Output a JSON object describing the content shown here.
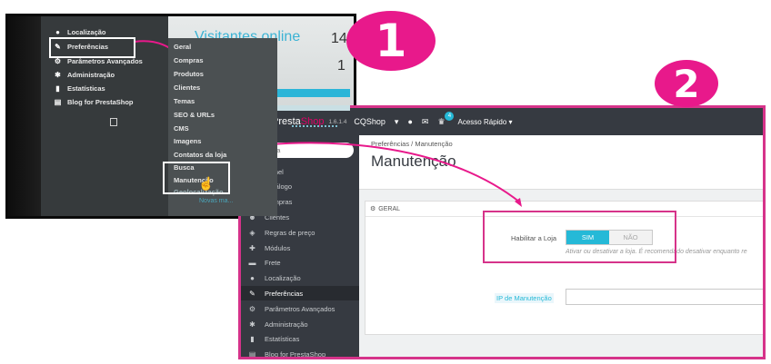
{
  "step_badges": [
    "1",
    "2"
  ],
  "old_admin": {
    "visitors_label": "Visitantes online",
    "stat_1": "14",
    "stat_2": "1",
    "menu": [
      {
        "label": "Localização",
        "icon": "globe-icon",
        "glyph": "●"
      },
      {
        "label": "Preferências",
        "icon": "wrench-icon",
        "glyph": "✎"
      },
      {
        "label": "Parâmetros Avançados",
        "icon": "cogs-icon",
        "glyph": "⚙"
      },
      {
        "label": "Administração",
        "icon": "gear-icon",
        "glyph": "✱"
      },
      {
        "label": "Estatísticas",
        "icon": "bar-chart-icon",
        "glyph": "▮"
      },
      {
        "label": "Blog for PrestaShop",
        "icon": "book-icon",
        "glyph": "▤"
      }
    ],
    "submenu": [
      "Geral",
      "Compras",
      "Produtos",
      "Clientes",
      "Temas",
      "SEO & URLs",
      "CMS",
      "Imagens",
      "Contatos da loja",
      "Busca",
      "Manutenção",
      "Geolocalização"
    ],
    "faded_link": "Novas ma..."
  },
  "new_admin": {
    "brand_part1": "Presta",
    "brand_part2": "Shop",
    "version": "1.6.1.4",
    "shop_name": "CQShop",
    "notification_count": "4",
    "quick_access": "Acesso Rápido ▾",
    "search_placeholder": "Busca",
    "nav": [
      {
        "label": "Painel",
        "icon": "dashboard-icon",
        "glyph": "◔"
      },
      {
        "label": "Catálogo",
        "icon": "book-icon",
        "glyph": "▤"
      },
      {
        "label": "Compras",
        "icon": "credit-card-icon",
        "glyph": "▭"
      },
      {
        "label": "Clientes",
        "icon": "users-icon",
        "glyph": "☻"
      },
      {
        "label": "Regras de preço",
        "icon": "tags-icon",
        "glyph": "◈"
      },
      {
        "label": "Módulos",
        "icon": "puzzle-icon",
        "glyph": "✚"
      },
      {
        "label": "Frete",
        "icon": "truck-icon",
        "glyph": "▬"
      },
      {
        "label": "Localização",
        "icon": "globe-icon",
        "glyph": "●"
      },
      {
        "label": "Preferências",
        "icon": "wrench-icon",
        "glyph": "✎",
        "active": true
      },
      {
        "label": "Parâmetros Avançados",
        "icon": "cogs-icon",
        "glyph": "⚙"
      },
      {
        "label": "Administração",
        "icon": "gear-icon",
        "glyph": "✱"
      },
      {
        "label": "Estatísticas",
        "icon": "bar-chart-icon",
        "glyph": "▮"
      },
      {
        "label": "Blog for PrestaShop",
        "icon": "book-icon",
        "glyph": "▤"
      }
    ],
    "breadcrumb": "Preferências  /  Manutenção",
    "page_title": "Manutenção",
    "section_title": "GERAL",
    "enable_store_label": "Habilitar a Loja",
    "toggle_on": "SIM",
    "toggle_off": "NÃO",
    "help_text": "Ativar ou desativar a loja. É recomendado desativar enquanto re",
    "ip_label": "IP de Manutenção",
    "ip_value": ""
  },
  "colors": {
    "annotation_pink": "#e8198b",
    "accent_blue": "#25b9d7",
    "sidebar_dark": "#363a41"
  }
}
